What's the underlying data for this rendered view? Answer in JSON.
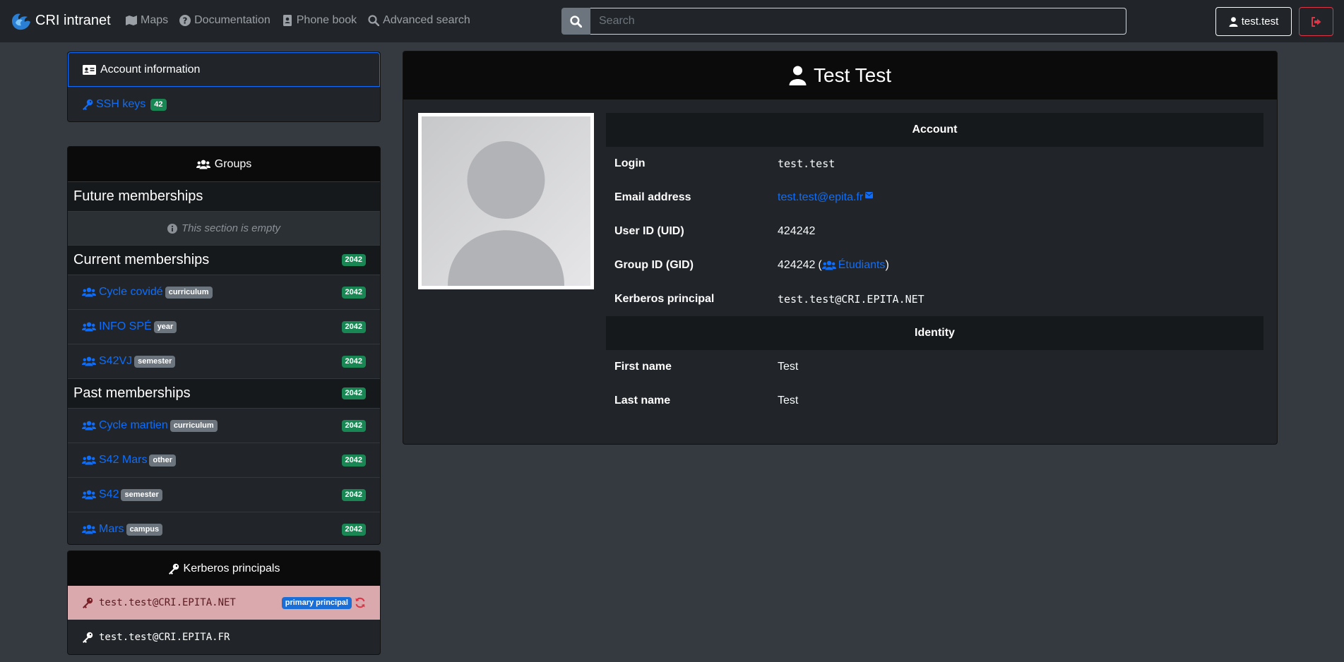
{
  "navbar": {
    "brand": "CRI intranet",
    "links": [
      {
        "label": "Maps",
        "icon": "map-icon"
      },
      {
        "label": "Documentation",
        "icon": "question-circle-icon"
      },
      {
        "label": "Phone book",
        "icon": "address-book-icon"
      },
      {
        "label": "Advanced search",
        "icon": "search-icon"
      }
    ],
    "search_placeholder": "Search",
    "user_label": "test.test"
  },
  "sidebar": {
    "account_info_label": "Account information",
    "ssh_keys_label": "SSH keys",
    "ssh_keys_count": "42",
    "groups": {
      "header": "Groups",
      "future": {
        "title": "Future memberships",
        "empty_text": "This section is empty"
      },
      "current": {
        "title": "Current memberships",
        "count": "2042",
        "items": [
          {
            "name": "Cycle covidé",
            "type": "curriculum",
            "count": "2042"
          },
          {
            "name": "INFO SPÉ",
            "type": "year",
            "count": "2042"
          },
          {
            "name": "S42VJ",
            "type": "semester",
            "count": "2042"
          }
        ]
      },
      "past": {
        "title": "Past memberships",
        "count": "2042",
        "items": [
          {
            "name": "Cycle martien",
            "type": "curriculum",
            "count": "2042"
          },
          {
            "name": "S42 Mars",
            "type": "other",
            "count": "2042"
          },
          {
            "name": "S42",
            "type": "semester",
            "count": "2042"
          },
          {
            "name": "Mars",
            "type": "campus",
            "count": "2042"
          }
        ]
      }
    },
    "kerberos": {
      "header": "Kerberos principals",
      "principals": [
        {
          "name": "test.test@CRI.EPITA.NET",
          "badge": "primary principal"
        },
        {
          "name": "test.test@CRI.EPITA.FR"
        }
      ]
    }
  },
  "profile": {
    "display_name": "Test Test",
    "account_section": "Account",
    "identity_section": "Identity",
    "fields": {
      "login": {
        "label": "Login",
        "value": "test.test"
      },
      "email": {
        "label": "Email address",
        "value": "test.test@epita.fr"
      },
      "uid": {
        "label": "User ID (UID)",
        "value": "424242"
      },
      "gid": {
        "label": "Group ID (GID)",
        "value": "424242",
        "group": "Étudiants"
      },
      "kerberos": {
        "label": "Kerberos principal",
        "value": "test.test@CRI.EPITA.NET"
      },
      "first_name": {
        "label": "First name",
        "value": "Test"
      },
      "last_name": {
        "label": "Last name",
        "value": "Test"
      }
    }
  },
  "colors": {
    "background": "#343a40",
    "navbar": "#212529",
    "link": "#0d6efd",
    "success_badge": "#198754",
    "primary_principal_row": "#d9a9ad",
    "danger": "#dc3545"
  }
}
